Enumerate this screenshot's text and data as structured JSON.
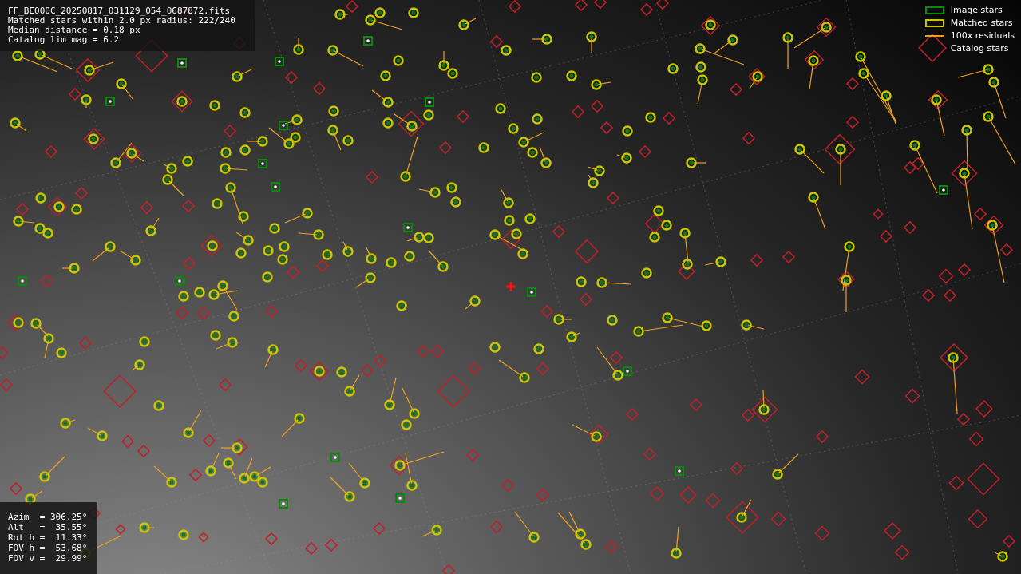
{
  "header": {
    "lines": [
      "FF_BE000C_20250817_031129_054_0687872.fits",
      "Matched stars within 2.0 px radius: 222/240",
      "Median distance = 0.18 px",
      "Catalog lim mag = 6.2"
    ]
  },
  "legend": [
    {
      "kind": "image",
      "label": "Image stars"
    },
    {
      "kind": "matched",
      "label": "Matched stars"
    },
    {
      "kind": "residual",
      "label": "100x residuals"
    },
    {
      "kind": "catalog",
      "label": "Catalog stars"
    }
  ],
  "pointing": {
    "lines": [
      "Azim  = 306.25°",
      "Alt   =  35.55°",
      "Rot h =  11.33°",
      "FOV h =  53.68°",
      "FOV v =  29.99°"
    ]
  }
}
